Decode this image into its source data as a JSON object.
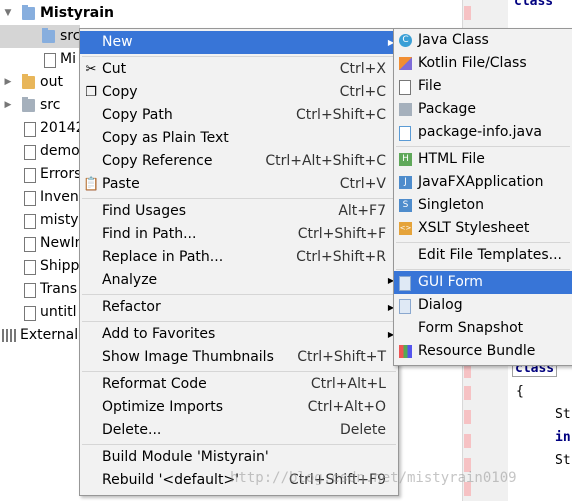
{
  "tree": {
    "items": [
      {
        "label": "Mistyrain"
      },
      {
        "label": "src"
      },
      {
        "label": "Mi"
      },
      {
        "label": "out"
      },
      {
        "label": "src"
      },
      {
        "label": "20142"
      },
      {
        "label": "demo"
      },
      {
        "label": "Errors"
      },
      {
        "label": "Inven"
      },
      {
        "label": "mistyr"
      },
      {
        "label": "NewIn"
      },
      {
        "label": "Shipp"
      },
      {
        "label": "Trans"
      },
      {
        "label": "untitl"
      },
      {
        "label": "External"
      }
    ]
  },
  "editor": {
    "class_top": "class",
    "class_mid": "class",
    "line_brace": "{",
    "line_st1": "St",
    "line_in": "in",
    "line_st2": "St"
  },
  "menu": {
    "items": [
      {
        "label": "New",
        "shortcut": ""
      },
      {
        "label": "Cut",
        "shortcut": "Ctrl+X"
      },
      {
        "label": "Copy",
        "shortcut": "Ctrl+C"
      },
      {
        "label": "Copy Path",
        "shortcut": "Ctrl+Shift+C"
      },
      {
        "label": "Copy as Plain Text",
        "shortcut": ""
      },
      {
        "label": "Copy Reference",
        "shortcut": "Ctrl+Alt+Shift+C"
      },
      {
        "label": "Paste",
        "shortcut": "Ctrl+V"
      },
      {
        "label": "Find Usages",
        "shortcut": "Alt+F7"
      },
      {
        "label": "Find in Path...",
        "shortcut": "Ctrl+Shift+F"
      },
      {
        "label": "Replace in Path...",
        "shortcut": "Ctrl+Shift+R"
      },
      {
        "label": "Analyze",
        "shortcut": ""
      },
      {
        "label": "Refactor",
        "shortcut": ""
      },
      {
        "label": "Add to Favorites",
        "shortcut": ""
      },
      {
        "label": "Show Image Thumbnails",
        "shortcut": "Ctrl+Shift+T"
      },
      {
        "label": "Reformat Code",
        "shortcut": "Ctrl+Alt+L"
      },
      {
        "label": "Optimize Imports",
        "shortcut": "Ctrl+Alt+O"
      },
      {
        "label": "Delete...",
        "shortcut": "Delete"
      },
      {
        "label": "Build Module 'Mistyrain'",
        "shortcut": ""
      },
      {
        "label": "Rebuild '<default>'",
        "shortcut": "Ctrl+Shift+F9"
      }
    ]
  },
  "submenu": {
    "items": [
      {
        "label": "Java Class"
      },
      {
        "label": "Kotlin File/Class"
      },
      {
        "label": "File"
      },
      {
        "label": "Package"
      },
      {
        "label": "package-info.java"
      },
      {
        "label": "HTML File"
      },
      {
        "label": "JavaFXApplication"
      },
      {
        "label": "Singleton"
      },
      {
        "label": "XSLT Stylesheet"
      },
      {
        "label": "Edit File Templates..."
      },
      {
        "label": "GUI Form"
      },
      {
        "label": "Dialog"
      },
      {
        "label": "Form Snapshot"
      },
      {
        "label": "Resource Bundle"
      }
    ]
  },
  "icons": {
    "java_class": "C",
    "html": "H",
    "javafx": "J",
    "singleton": "S",
    "xslt": "<>"
  },
  "watermark": "http://blog.csdn.net/mistyrain0109",
  "colors": {
    "highlight": "#3875d7",
    "menu_bg": "#f2f2f2",
    "selection_grey": "#d5d5d5"
  }
}
